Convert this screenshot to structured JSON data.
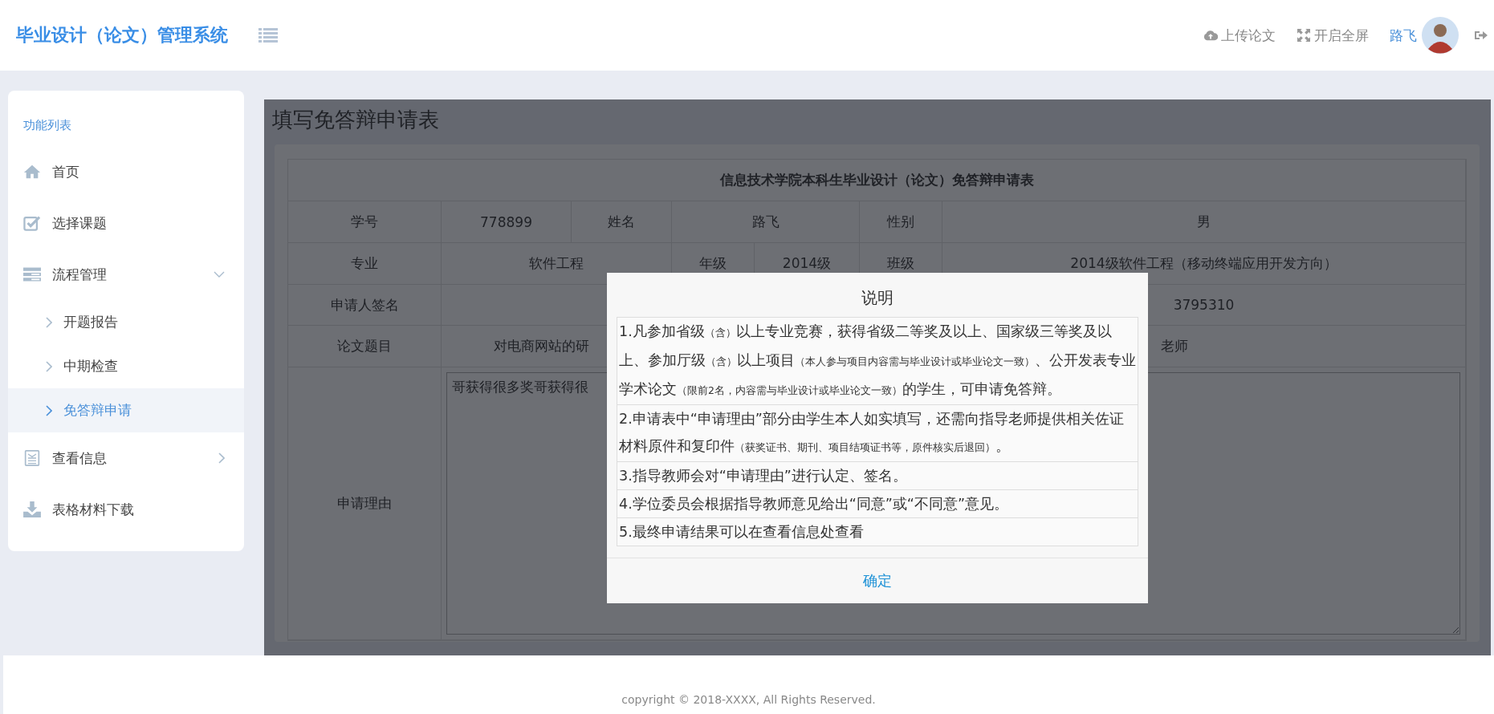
{
  "header": {
    "title": "毕业设计（论文）管理系统",
    "actions": [
      {
        "kind": "upload",
        "label": "上传论文"
      },
      {
        "kind": "fullscreen",
        "label": "开启全屏"
      }
    ],
    "user": {
      "name": "路飞"
    }
  },
  "sidebar": {
    "heading": "功能列表",
    "items": [
      {
        "kind": "home",
        "label": "首页",
        "selected": false
      },
      {
        "kind": "check",
        "label": "选择课题",
        "selected": false
      },
      {
        "kind": "flow",
        "label": "流程管理",
        "selected": false,
        "expanded": true,
        "children": [
          {
            "label": "开题报告",
            "selected": false
          },
          {
            "label": "中期检查",
            "selected": false
          },
          {
            "label": "免答辩申请",
            "selected": true
          }
        ]
      },
      {
        "kind": "info",
        "label": "查看信息",
        "selected": false,
        "expanded": false
      },
      {
        "kind": "download",
        "label": "表格材料下载",
        "selected": false
      }
    ]
  },
  "page": {
    "title": "填写免答辩申请表",
    "form_title": "信息技术学院本科生毕业设计（论文）免答辩申请表",
    "rows": [
      [
        "学号",
        "778899",
        "姓名",
        "路飞",
        "性别",
        "男"
      ],
      [
        "专业",
        "软件工程",
        "年级",
        "2014级",
        "班级",
        "2014级软件工程（移动终端应用开发方向）"
      ],
      [
        "申请人签名",
        "",
        "3795310"
      ],
      [
        "论文题目",
        "对电商网站的研",
        "老师"
      ]
    ],
    "reason": {
      "label": "申请理由",
      "value": "哥获得很多奖哥获得很"
    }
  },
  "modal": {
    "title": "说明",
    "notes": [
      [
        {
          "text": "1.凡参加省级",
          "small": false
        },
        {
          "text": "（含）",
          "small": true
        },
        {
          "text": "以上专业竞赛，获得省级二等奖及以上、国家级三等奖及以上、参加厅级",
          "small": false
        },
        {
          "text": "（含）",
          "small": true
        },
        {
          "text": "以上项目",
          "small": false
        },
        {
          "text": "（本人参与项目内容需与毕业设计或毕业论文一致）",
          "small": true
        },
        {
          "text": "、公开发表专业学术论文",
          "small": false
        },
        {
          "text": "（限前2名，内容需与毕业设计或毕业论文一致）",
          "small": true
        },
        {
          "text": "的学生，可申请免答辩。",
          "small": false
        }
      ],
      [
        {
          "text": "2.申请表中“申请理由”部分由学生本人如实填写，还需向指导老师提供相关佐证材料原件和复印件",
          "small": false
        },
        {
          "text": "（获奖证书、期刊、项目结项证书等，原件核实后退回）",
          "small": true
        },
        {
          "text": "。",
          "small": false
        }
      ],
      [
        {
          "text": "3.指导教师会对“申请理由”进行认定、签名。",
          "small": false
        }
      ],
      [
        {
          "text": "4.学位委员会根据指导教师意见给出“同意”或“不同意”意见。",
          "small": false
        }
      ],
      [
        {
          "text": "5.最终申请结果可以在查看信息处查看",
          "small": false
        }
      ]
    ],
    "confirm": "确定"
  },
  "footer": "copyright © 2018-XXXX, All Rights Reserved."
}
